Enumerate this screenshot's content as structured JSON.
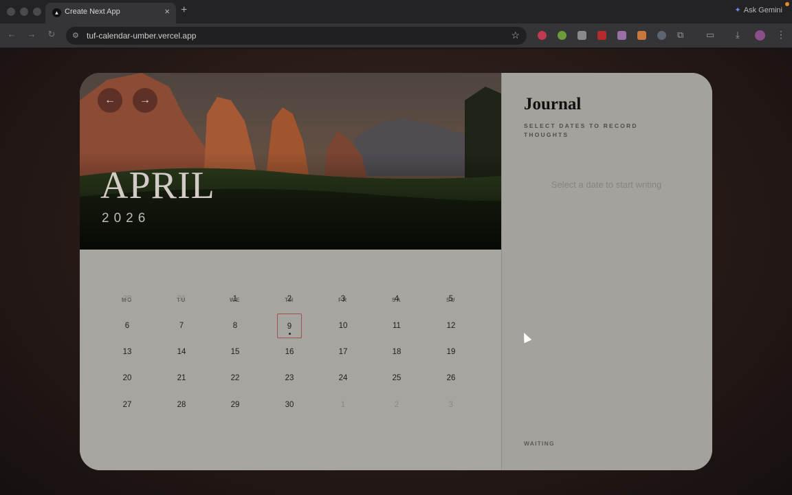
{
  "browser": {
    "tab_title": "Create Next App",
    "tab_favicon": "▲",
    "tab_close": "×",
    "new_tab": "+",
    "url": "tuf-calendar-umber.vercel.app",
    "ask_gemini": "Ask Gemini"
  },
  "calendar": {
    "month": "APRIL",
    "year": "2026",
    "prev_label": "←",
    "next_label": "→",
    "weekdays": [
      "MO",
      "TU",
      "WE",
      "TH",
      "FR",
      "SA",
      "SU"
    ],
    "weeks": [
      [
        {
          "d": "30",
          "out": true
        },
        {
          "d": "31",
          "out": true
        },
        {
          "d": "1"
        },
        {
          "d": "2"
        },
        {
          "d": "3"
        },
        {
          "d": "4"
        },
        {
          "d": "5"
        }
      ],
      [
        {
          "d": "6"
        },
        {
          "d": "7"
        },
        {
          "d": "8"
        },
        {
          "d": "9",
          "today": true
        },
        {
          "d": "10"
        },
        {
          "d": "11"
        },
        {
          "d": "12"
        }
      ],
      [
        {
          "d": "13"
        },
        {
          "d": "14"
        },
        {
          "d": "15"
        },
        {
          "d": "16"
        },
        {
          "d": "17"
        },
        {
          "d": "18"
        },
        {
          "d": "19"
        }
      ],
      [
        {
          "d": "20"
        },
        {
          "d": "21"
        },
        {
          "d": "22"
        },
        {
          "d": "23"
        },
        {
          "d": "24"
        },
        {
          "d": "25"
        },
        {
          "d": "26"
        }
      ],
      [
        {
          "d": "27"
        },
        {
          "d": "28"
        },
        {
          "d": "29"
        },
        {
          "d": "30"
        },
        {
          "d": "1",
          "out": true
        },
        {
          "d": "2",
          "out": true
        },
        {
          "d": "3",
          "out": true
        }
      ]
    ]
  },
  "journal": {
    "title": "Journal",
    "subtitle": "SELECT DATES TO RECORD THOUGHTS",
    "placeholder": "Select a date to start writing",
    "status": "WAITING"
  }
}
